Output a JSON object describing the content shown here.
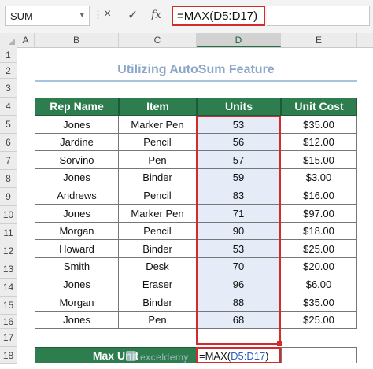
{
  "formula_bar": {
    "name_box": "SUM",
    "more_icon": "vertical-dots",
    "cancel_icon": "×",
    "enter_icon": "✓",
    "fx_icon": "fx",
    "formula": "=MAX(D5:D17)"
  },
  "columns": [
    "A",
    "B",
    "C",
    "D",
    "E"
  ],
  "rows": [
    "1",
    "2",
    "3",
    "4",
    "5",
    "6",
    "7",
    "8",
    "9",
    "10",
    "11",
    "12",
    "13",
    "14",
    "15",
    "16",
    "17",
    "18"
  ],
  "title": "Utilizing AutoSum Feature",
  "table": {
    "headers": [
      "Rep Name",
      "Item",
      "Units",
      "Unit Cost"
    ],
    "rows": [
      [
        "Jones",
        "Marker Pen",
        "53",
        "$35.00"
      ],
      [
        "Jardine",
        "Pencil",
        "56",
        "$12.00"
      ],
      [
        "Sorvino",
        "Pen",
        "57",
        "$15.00"
      ],
      [
        "Jones",
        "Binder",
        "59",
        "$3.00"
      ],
      [
        "Andrews",
        "Pencil",
        "83",
        "$16.00"
      ],
      [
        "Jones",
        "Marker Pen",
        "71",
        "$97.00"
      ],
      [
        "Morgan",
        "Pencil",
        "90",
        "$18.00"
      ],
      [
        "Howard",
        "Binder",
        "53",
        "$25.00"
      ],
      [
        "Smith",
        "Desk",
        "70",
        "$20.00"
      ],
      [
        "Jones",
        "Eraser",
        "96",
        "$6.00"
      ],
      [
        "Morgan",
        "Binder",
        "88",
        "$35.00"
      ],
      [
        "Jones",
        "Pen",
        "68",
        "$25.00"
      ]
    ]
  },
  "max_row": {
    "label": "Max Unit",
    "cell_prefix": "=MAX(",
    "cell_ref": "D5:D17",
    "cell_suffix": ")"
  },
  "watermark": "exceldemy",
  "colors": {
    "header_green": "#2e7d4f",
    "highlight_red": "#d22b2b",
    "selection_blue": "#e6ecf7",
    "title_blue": "#8ca6c8"
  }
}
